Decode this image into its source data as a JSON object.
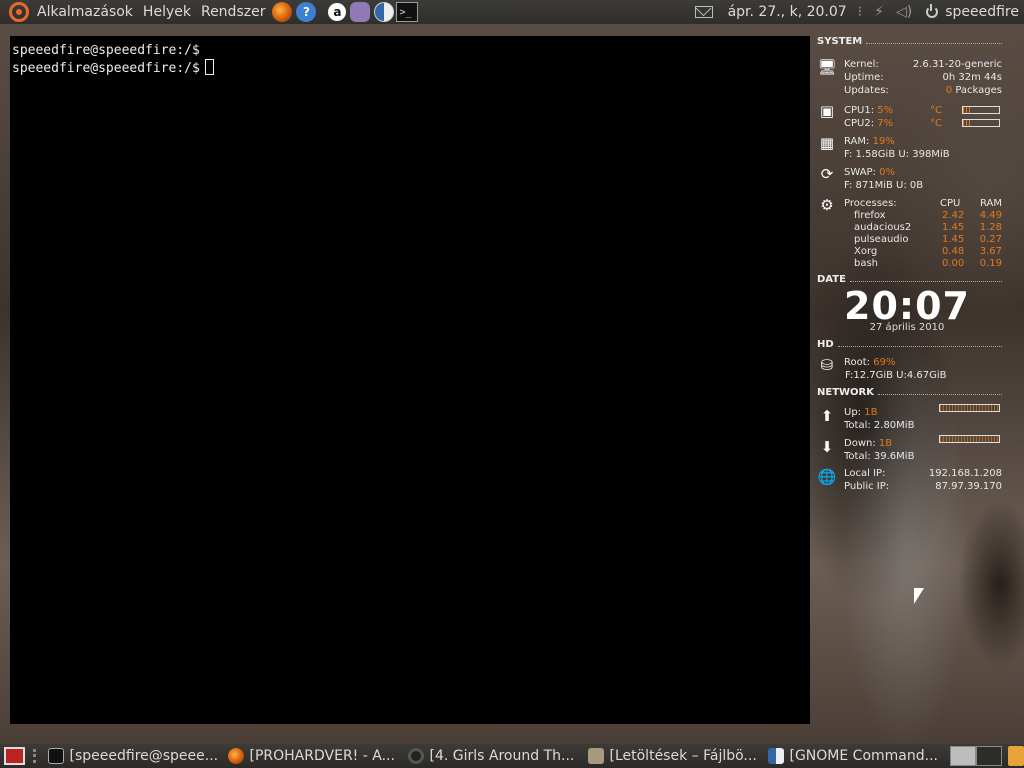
{
  "top_panel": {
    "menus": [
      "Alkalmazások",
      "Helyek",
      "Rendszer"
    ],
    "help_icon_glyph": "?",
    "app_a_glyph": "a",
    "terminal_glyph": ">_",
    "clock": "ápr. 27., k, 20.07",
    "user": "speeedfire"
  },
  "terminal": {
    "lines": [
      "speeedfire@speeedfire:/$",
      "speeedfire@speeedfire:/$"
    ]
  },
  "conky": {
    "system_title": "SYSTEM",
    "kernel_label": "Kernel:",
    "kernel_value": "2.6.31-20-generic",
    "uptime_label": "Uptime:",
    "uptime_value": "0h 32m 44s",
    "updates_label": "Updates:",
    "updates_count": "0",
    "updates_suffix": " Packages",
    "cpu1_label": "CPU1:",
    "cpu1_value": "5%",
    "cpu1_temp": "°C",
    "cpu2_label": "CPU2:",
    "cpu2_value": "7%",
    "cpu2_temp": "°C",
    "cpu1_bar": 0.2,
    "cpu2_bar": 0.25,
    "ram_label": "RAM:",
    "ram_value": "19%",
    "ram_detail": "F: 1.58GiB U: 398MiB",
    "swap_label": "SWAP:",
    "swap_value": "0%",
    "swap_detail": "F: 871MiB U: 0B",
    "processes_label": "Processes:",
    "col_cpu": "CPU",
    "col_ram": "RAM",
    "processes": [
      {
        "name": "firefox",
        "cpu": "2.42",
        "ram": "4.49"
      },
      {
        "name": "audacious2",
        "cpu": "1.45",
        "ram": "1.28"
      },
      {
        "name": "pulseaudio",
        "cpu": "1.45",
        "ram": "0.27"
      },
      {
        "name": "Xorg",
        "cpu": "0.48",
        "ram": "3.67"
      },
      {
        "name": "bash",
        "cpu": "0.00",
        "ram": "0.19"
      }
    ],
    "date_title": "DATE",
    "time": "20:07",
    "date": "27 április 2010",
    "hd_title": "HD",
    "root_label": "Root:",
    "root_value": "69%",
    "root_detail": "F:12.7GiB U:4.67GiB",
    "network_title": "NETWORK",
    "up_label": "Up:",
    "up_value": "1B",
    "up_total": "Total: 2.80MiB",
    "down_label": "Down:",
    "down_value": "1B",
    "down_total": "Total: 39.6MiB",
    "local_ip_label": "Local IP:",
    "local_ip": "192.168.1.208",
    "public_ip_label": "Public IP:",
    "public_ip": "87.97.39.170"
  },
  "taskbar": {
    "tasks": [
      {
        "label": "[speeedfire@speee...",
        "icon": "terminal-icon"
      },
      {
        "label": "[PROHARDVER! - A...",
        "icon": "firefox-icon"
      },
      {
        "label": "[4. Girls Around Th...",
        "icon": "audacious-icon"
      },
      {
        "label": "[Letöltések – Fájlbö...",
        "icon": "folder-icon"
      },
      {
        "label": "[GNOME Command...",
        "icon": "gnome-commander-icon"
      }
    ]
  },
  "colors": {
    "accent": "#e27a1c",
    "terminal_bg": "#000000",
    "panel_bg": "#3c3b37"
  }
}
